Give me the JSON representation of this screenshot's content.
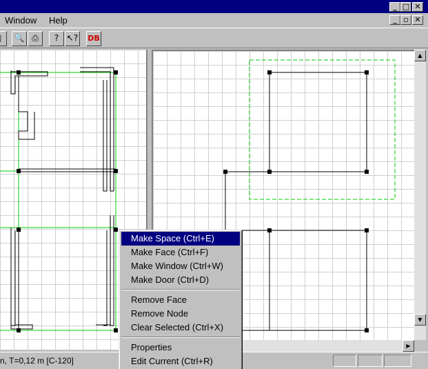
{
  "menubar": {
    "window_label": "Window",
    "help_label": "Help"
  },
  "toolbar": {
    "db_label": "DB"
  },
  "context_menu": {
    "make_space": "Make Space (Ctrl+E)",
    "make_face": "Make Face (Ctrl+F)",
    "make_window": "Make Window (Ctrl+W)",
    "make_door": "Make Door (Ctrl+D)",
    "remove_face": "Remove Face",
    "remove_node": "Remove Node",
    "clear_selected": "Clear Selected (Ctrl+X)",
    "properties": "Properties",
    "edit_current": "Edit Current (Ctrl+R)"
  },
  "statusbar": {
    "text": "n, T=0,12 m [C-120]"
  },
  "colors": {
    "titlebar": "#000080",
    "space_outline": "#00cc00",
    "selection": "#000080"
  }
}
